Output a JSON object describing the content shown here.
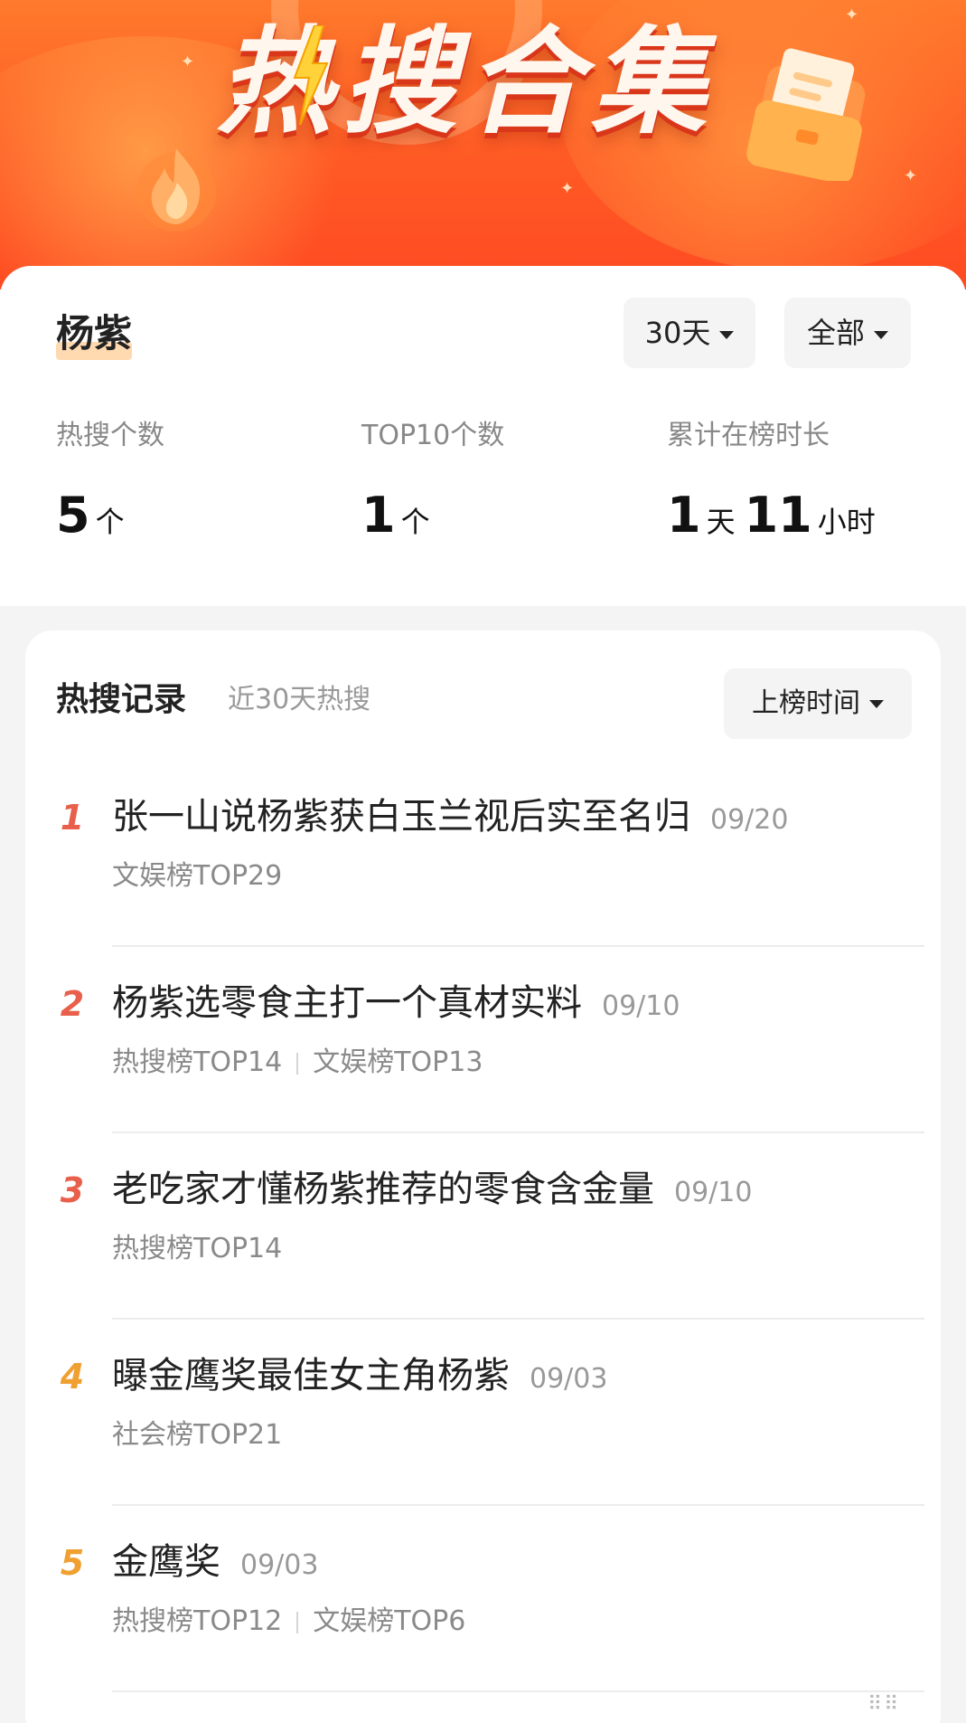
{
  "banner": {
    "title": "热搜合集"
  },
  "summary": {
    "name": "杨紫",
    "period_filter": "30天",
    "category_filter": "全部",
    "stats": [
      {
        "label": "热搜个数",
        "value": "5",
        "unit": "个"
      },
      {
        "label": "TOP10个数",
        "value": "1",
        "unit": "个"
      },
      {
        "label": "累计在榜时长",
        "days": "1",
        "days_unit": "天",
        "hours": "11",
        "hours_unit": "小时"
      }
    ]
  },
  "records": {
    "title": "热搜记录",
    "subtitle": "近30天热搜",
    "sort_label": "上榜时间",
    "items": [
      {
        "rank": "1",
        "rank_color": "#e8604c",
        "title": "张一山说杨紫获白玉兰视后实至名归",
        "date": "09/20",
        "tags": [
          "文娱榜TOP29"
        ]
      },
      {
        "rank": "2",
        "rank_color": "#e8604c",
        "title": "杨紫选零食主打一个真材实料",
        "date": "09/10",
        "tags": [
          "热搜榜TOP14",
          "文娱榜TOP13"
        ]
      },
      {
        "rank": "3",
        "rank_color": "#e8604c",
        "title": "老吃家才懂杨紫推荐的零食含金量",
        "date": "09/10",
        "tags": [
          "热搜榜TOP14"
        ]
      },
      {
        "rank": "4",
        "rank_color": "#f0a030",
        "title": "曝金鹰奖最佳女主角杨紫",
        "date": "09/03",
        "tags": [
          "社会榜TOP21"
        ]
      },
      {
        "rank": "5",
        "rank_color": "#f0a030",
        "title": "金鹰奖",
        "date": "09/03",
        "tags": [
          "热搜榜TOP12",
          "文娱榜TOP6"
        ]
      }
    ]
  }
}
